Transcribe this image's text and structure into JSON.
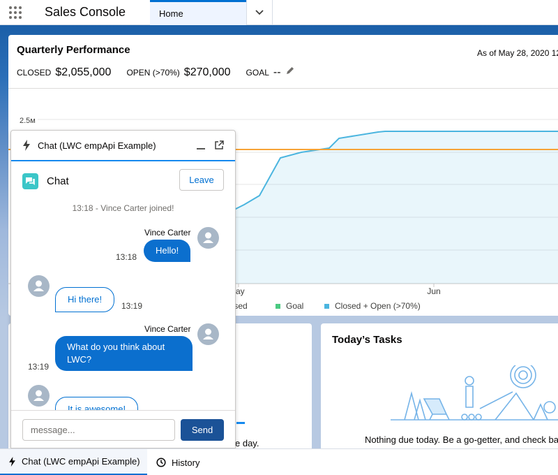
{
  "header": {
    "app_name": "Sales Console",
    "tab_home": "Home"
  },
  "performance": {
    "title": "Quarterly Performance",
    "as_of": "As of May 28, 2020 12",
    "closed_label": "CLOSED",
    "closed_value": "$2,055,000",
    "open_label": "OPEN (>70%)",
    "open_value": "$270,000",
    "goal_label": "GOAL",
    "goal_value": "--",
    "legend_closed": "losed",
    "legend_goal": "Goal",
    "legend_open": "Closed + Open (>70%)"
  },
  "chart_data": {
    "type": "line",
    "y_tick_label": "2.5м",
    "x_tick_labels": [
      "ay",
      "Jun"
    ],
    "grid": true,
    "series": [
      {
        "name": "Goal",
        "color": "#f7a336"
      },
      {
        "name": "Closed + Open (>70%)",
        "color": "#4bb5df"
      }
    ]
  },
  "colors": {
    "accent": "#0070d2",
    "goal": "#f7a336",
    "legend_goal_swatch": "#4bca81",
    "open_line": "#4bb5df",
    "send_button": "#1b5297"
  },
  "chat_panel": {
    "title": "Chat (LWC empApi Example)",
    "sub_title": "Chat",
    "leave_label": "Leave",
    "system_message": "13:18 - Vince Carter joined!",
    "messages": [
      {
        "direction": "out",
        "sender": "Vince Carter",
        "text": "Hello!",
        "time": "13:18"
      },
      {
        "direction": "in",
        "text": "Hi there!",
        "time": "13:19"
      },
      {
        "direction": "out",
        "sender": "Vince Carter",
        "text": "What do you think about LWC?",
        "time": "13:19"
      },
      {
        "direction": "in",
        "text": "It is awesome!"
      }
    ],
    "input_placeholder": "message...",
    "send_label": "Send"
  },
  "left_card": {
    "text_fragment": "e day."
  },
  "tasks": {
    "title": "Today’s Tasks",
    "empty_text": "Nothing due today. Be a go-getter, and check bac"
  },
  "utility_bar": {
    "chat_label": "Chat (LWC empApi Example)",
    "history_label": "History"
  },
  "icons": [
    "waffle-icon",
    "chevron-down-icon",
    "pencil-icon",
    "bolt-icon",
    "minimize-icon",
    "popout-icon",
    "chat-bubble-icon",
    "avatar-icon",
    "clock-icon"
  ]
}
